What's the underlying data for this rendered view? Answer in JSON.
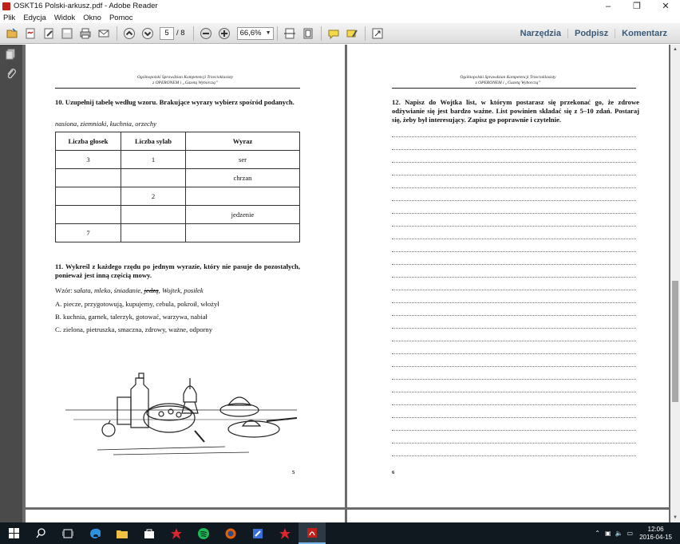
{
  "window": {
    "title": "OSKT16 Polski-arkusz.pdf - Adobe Reader",
    "controls": {
      "minimize": "–",
      "maximize": "❐",
      "close": "✕"
    }
  },
  "menu": [
    "Plik",
    "Edycja",
    "Widok",
    "Okno",
    "Pomoc"
  ],
  "toolbar": {
    "page_current": "5",
    "page_total": "/ 8",
    "zoom": "66,6%",
    "tools_label": "Narzędzia",
    "sign_label": "Podpisz",
    "comment_label": "Komentarz"
  },
  "doc": {
    "header_line1": "Ogólnopolski Sprawdzian Kompetencji Trzecioklasisty",
    "header_line2": "z OPERONEM i „Gazetą Wyborczą”",
    "page_left": {
      "task10_title": "10. Uzupełnij tabelę według wzoru. Brakujące wyrazy wybierz spośród podanych.",
      "task10_words": "nasiona, ziemniaki, kuchnia, orzechy",
      "table": {
        "headers": [
          "Liczba głosek",
          "Liczba sylab",
          "Wyraz"
        ],
        "rows": [
          [
            "3",
            "1",
            "ser"
          ],
          [
            "",
            "",
            "chrzan"
          ],
          [
            "",
            "2",
            ""
          ],
          [
            "",
            "",
            "jedzenie"
          ],
          [
            "7",
            "",
            ""
          ]
        ]
      },
      "task11_title": "11. Wykreśl z każdego rzędu po jednym wyrazie, który nie pasuje do pozostałych, ponieważ jest inną częścią mowy.",
      "task11_example_label": "Wzór:",
      "task11_example_pre": "sałata, mleko, śniadanie,",
      "task11_example_struck": "jedzą",
      "task11_example_post": ", Wojtek, posiłek",
      "task11_lines": [
        "A. piecze, przygotowują, kupujemy, cebula, pokroił, włożył",
        "B. kuchnia, garnek, talerzyk, gotować, warzywa, nabiał",
        "C. zielona, pietruszka, smaczna, zdrowy, ważne, odporny"
      ],
      "page_number": "5"
    },
    "page_right": {
      "task12_text": "12. Napisz do Wojtka list, w którym postarasz się przekonać go, że zdrowe odżywianie się jest bardzo ważne. List powinien składać się z 5–10 zdań. Postaraj się, żeby był interesujący. Zapisz go poprawnie i czytelnie.",
      "page_number": "6"
    }
  },
  "taskbar": {
    "time": "12:06",
    "date": "2016-04-15"
  },
  "colors": {
    "accent_link": "#3a5a7a",
    "doc_bg": "#6b6b6b",
    "taskbar_bg": "#101820",
    "adobe_red": "#c0201a"
  }
}
